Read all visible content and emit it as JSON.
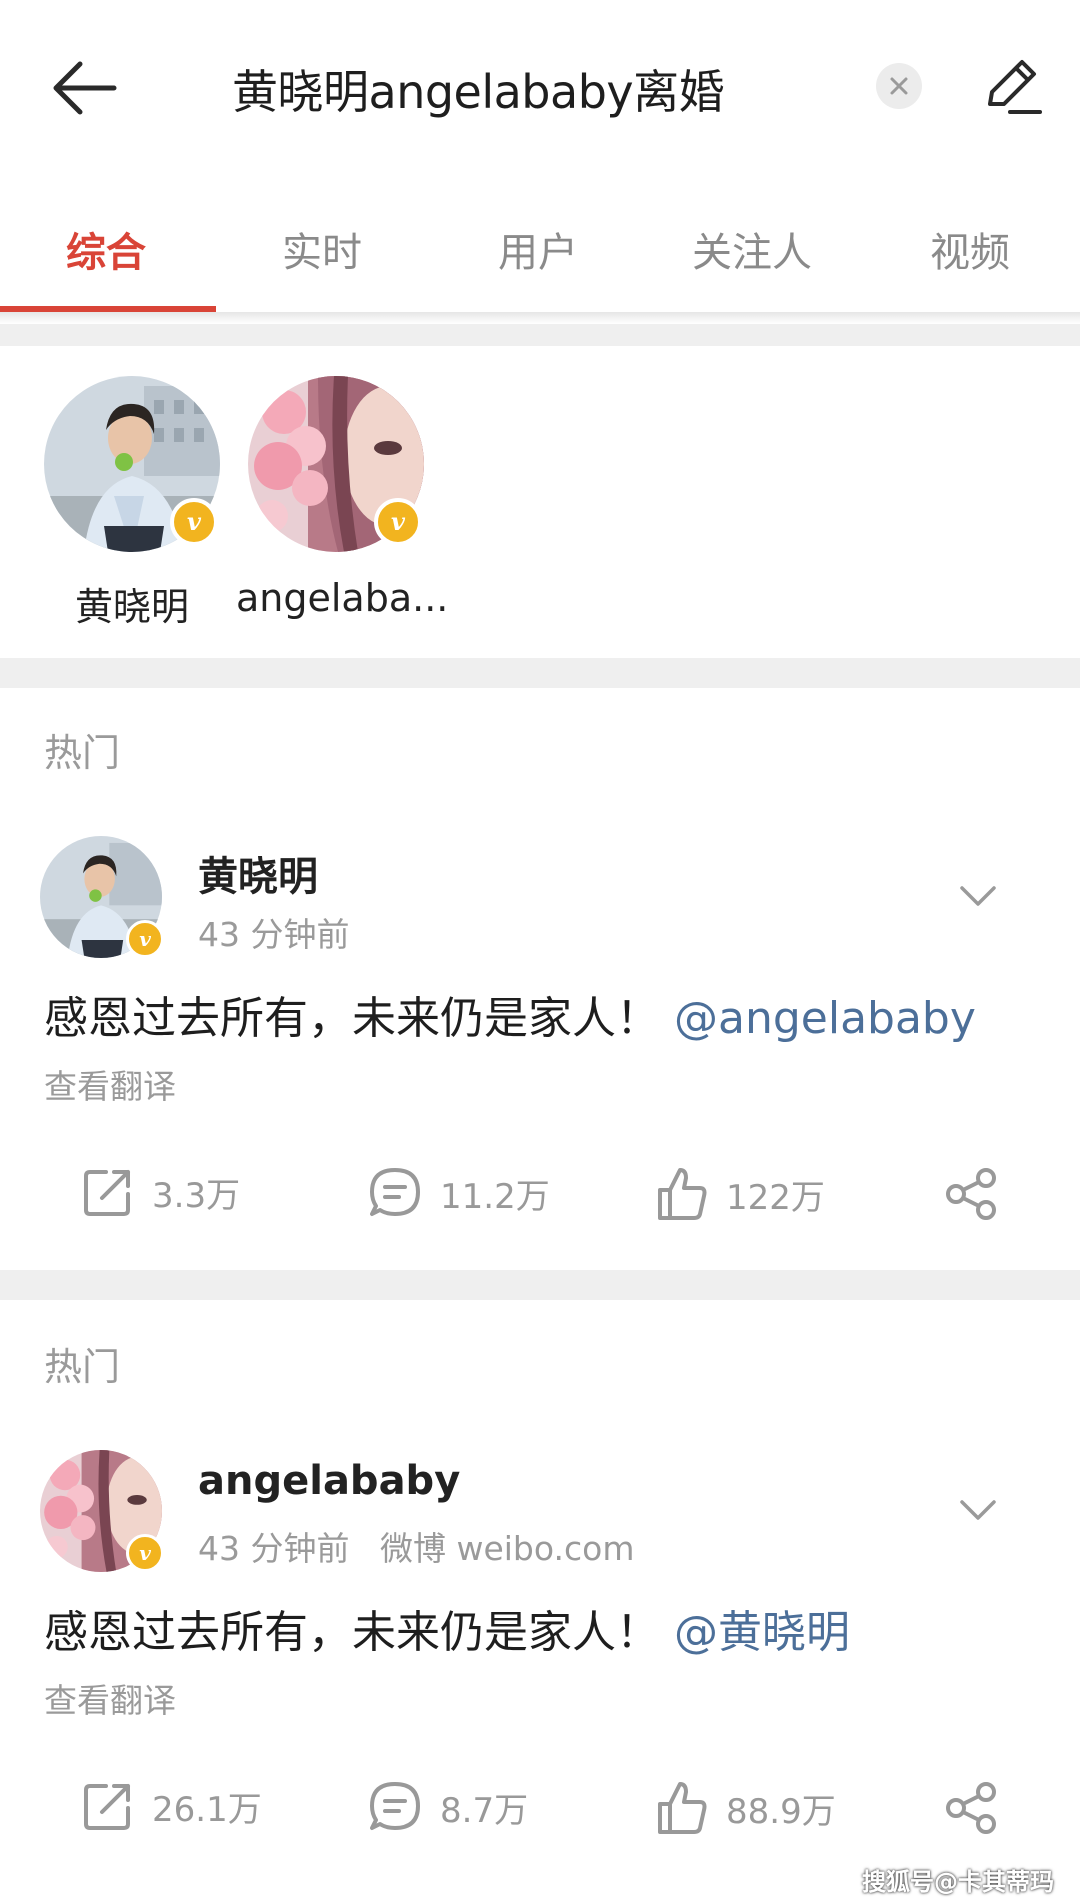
{
  "header": {
    "search_query": "黄晓明angelababy离婚"
  },
  "tabs": [
    {
      "label": "综合",
      "active": true
    },
    {
      "label": "实时",
      "active": false
    },
    {
      "label": "用户",
      "active": false
    },
    {
      "label": "关注人",
      "active": false
    },
    {
      "label": "视频",
      "active": false
    }
  ],
  "users": [
    {
      "name": "黄晓明",
      "verified": true,
      "avatar": "man-photo-avatar"
    },
    {
      "name": "angelaba...",
      "verified": true,
      "avatar": "woman-flower-avatar"
    }
  ],
  "posts": [
    {
      "section_label": "热门",
      "author": "黄晓明",
      "time": "43 分钟前",
      "source": "",
      "text": "感恩过去所有，未来仍是家人！",
      "mention": "@angelababy",
      "translate": "查看翻译",
      "reposts": "3.3万",
      "comments": "11.2万",
      "likes": "122万"
    },
    {
      "section_label": "热门",
      "author": "angelababy",
      "time": "43 分钟前",
      "source": "微博 weibo.com",
      "text": "感恩过去所有，未来仍是家人！",
      "mention": "@黄晓明",
      "translate": "查看翻译",
      "reposts": "26.1万",
      "comments": "8.7万",
      "likes": "88.9万"
    }
  ],
  "watermark": "搜狐号@卡其蒂玛",
  "colors": {
    "accent": "#d94437",
    "mention": "#4c6f99",
    "verified": "#f2b41f"
  }
}
